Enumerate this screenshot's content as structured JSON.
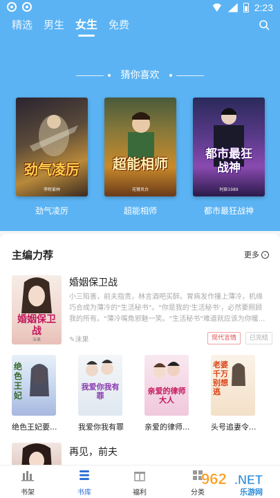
{
  "status": {
    "time": "2:23"
  },
  "tabs": [
    {
      "label": "精选",
      "active": false
    },
    {
      "label": "男生",
      "active": false
    },
    {
      "label": "女生",
      "active": true
    },
    {
      "label": "免费",
      "active": false
    }
  ],
  "guess": {
    "title": "猜你喜欢",
    "books": [
      {
        "name": "劲气凌厉",
        "cover_text": "劲气凌厉",
        "author": "李晖爱林"
      },
      {
        "name": "超能相师",
        "cover_text": "超能相师",
        "author": "花臂风台"
      },
      {
        "name": "都市最狂战神",
        "cover_text": "都市最狂战神",
        "author": "时辰1989"
      }
    ]
  },
  "editor": {
    "title": "主编力荐",
    "more_label": "更多",
    "featured": {
      "title": "婚姻保卫战",
      "description": "小三陷害，前夫指责，林言酒吧买醉。胃病发作撞上薄冷，机缘巧合成为薄冷的\"生活秘书\"。\"你是我的'生活秘书'，必然要照顾我的所有。\"薄冷嘴角邪魅一笑。\"生活秘书\"难道就应该为你暖...",
      "author": "沫果",
      "tags": [
        "现代言情",
        "已完结"
      ],
      "cover_text": "婚姻保卫战",
      "cover_author": "沫果"
    },
    "row": [
      {
        "name": "绝色王妃要...",
        "cover_text": "绝色王妃"
      },
      {
        "name": "我爱你我有罪",
        "cover_text": "我爱你我有罪"
      },
      {
        "name": "亲爱的律师...",
        "cover_text": "亲爱的律师大人"
      },
      {
        "name": "头号追妻令...",
        "cover_text": "老婆千万别想逃"
      }
    ],
    "next": {
      "title": "再见，前夫"
    }
  },
  "nav": [
    {
      "label": "书架",
      "icon": "bookshelf-icon",
      "active": false
    },
    {
      "label": "书库",
      "icon": "library-icon",
      "active": true
    },
    {
      "label": "福利",
      "icon": "gift-icon",
      "active": false
    },
    {
      "label": "分类",
      "icon": "category-icon",
      "active": false
    }
  ],
  "watermark": {
    "text": "962.NET",
    "subtext": "乐游网"
  },
  "colors": {
    "header_blue": "#5bb3f3",
    "accent_blue": "#2d6fd6",
    "tag_red": "#e24b4b"
  }
}
